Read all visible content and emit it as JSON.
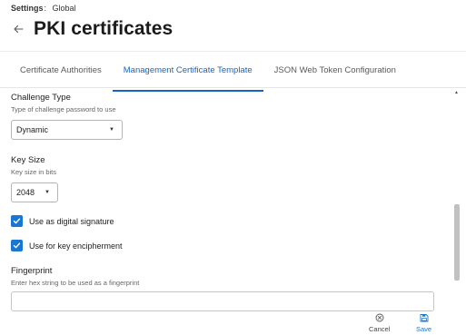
{
  "breadcrumb": {
    "label": "Settings",
    "separator": ":",
    "value": "Global"
  },
  "page": {
    "title": "PKI certificates"
  },
  "tabs": [
    {
      "label": "Certificate Authorities",
      "active": false
    },
    {
      "label": "Management Certificate Template",
      "active": true
    },
    {
      "label": "JSON Web Token Configuration",
      "active": false
    }
  ],
  "form": {
    "challenge_type": {
      "label": "Challenge Type",
      "help": "Type of challenge password to use",
      "value": "Dynamic"
    },
    "key_size": {
      "label": "Key Size",
      "help": "Key size in bits",
      "value": "2048"
    },
    "digital_signature": {
      "label": "Use as digital signature",
      "checked": true
    },
    "key_encipherment": {
      "label": "Use for key encipherment",
      "checked": true
    },
    "fingerprint": {
      "label": "Fingerprint",
      "help": "Enter hex string to be used as a fingerprint",
      "value": ""
    }
  },
  "footer": {
    "cancel_label": "Cancel",
    "save_label": "Save"
  },
  "icons": {
    "back": "arrow-left-icon",
    "dropdown": "caret-down-icon",
    "check": "check-icon",
    "cancel": "circle-x-icon",
    "save": "floppy-disk-icon"
  },
  "colors": {
    "accent": "#1976d2",
    "text": "#1f1f1f",
    "muted": "#666666"
  }
}
